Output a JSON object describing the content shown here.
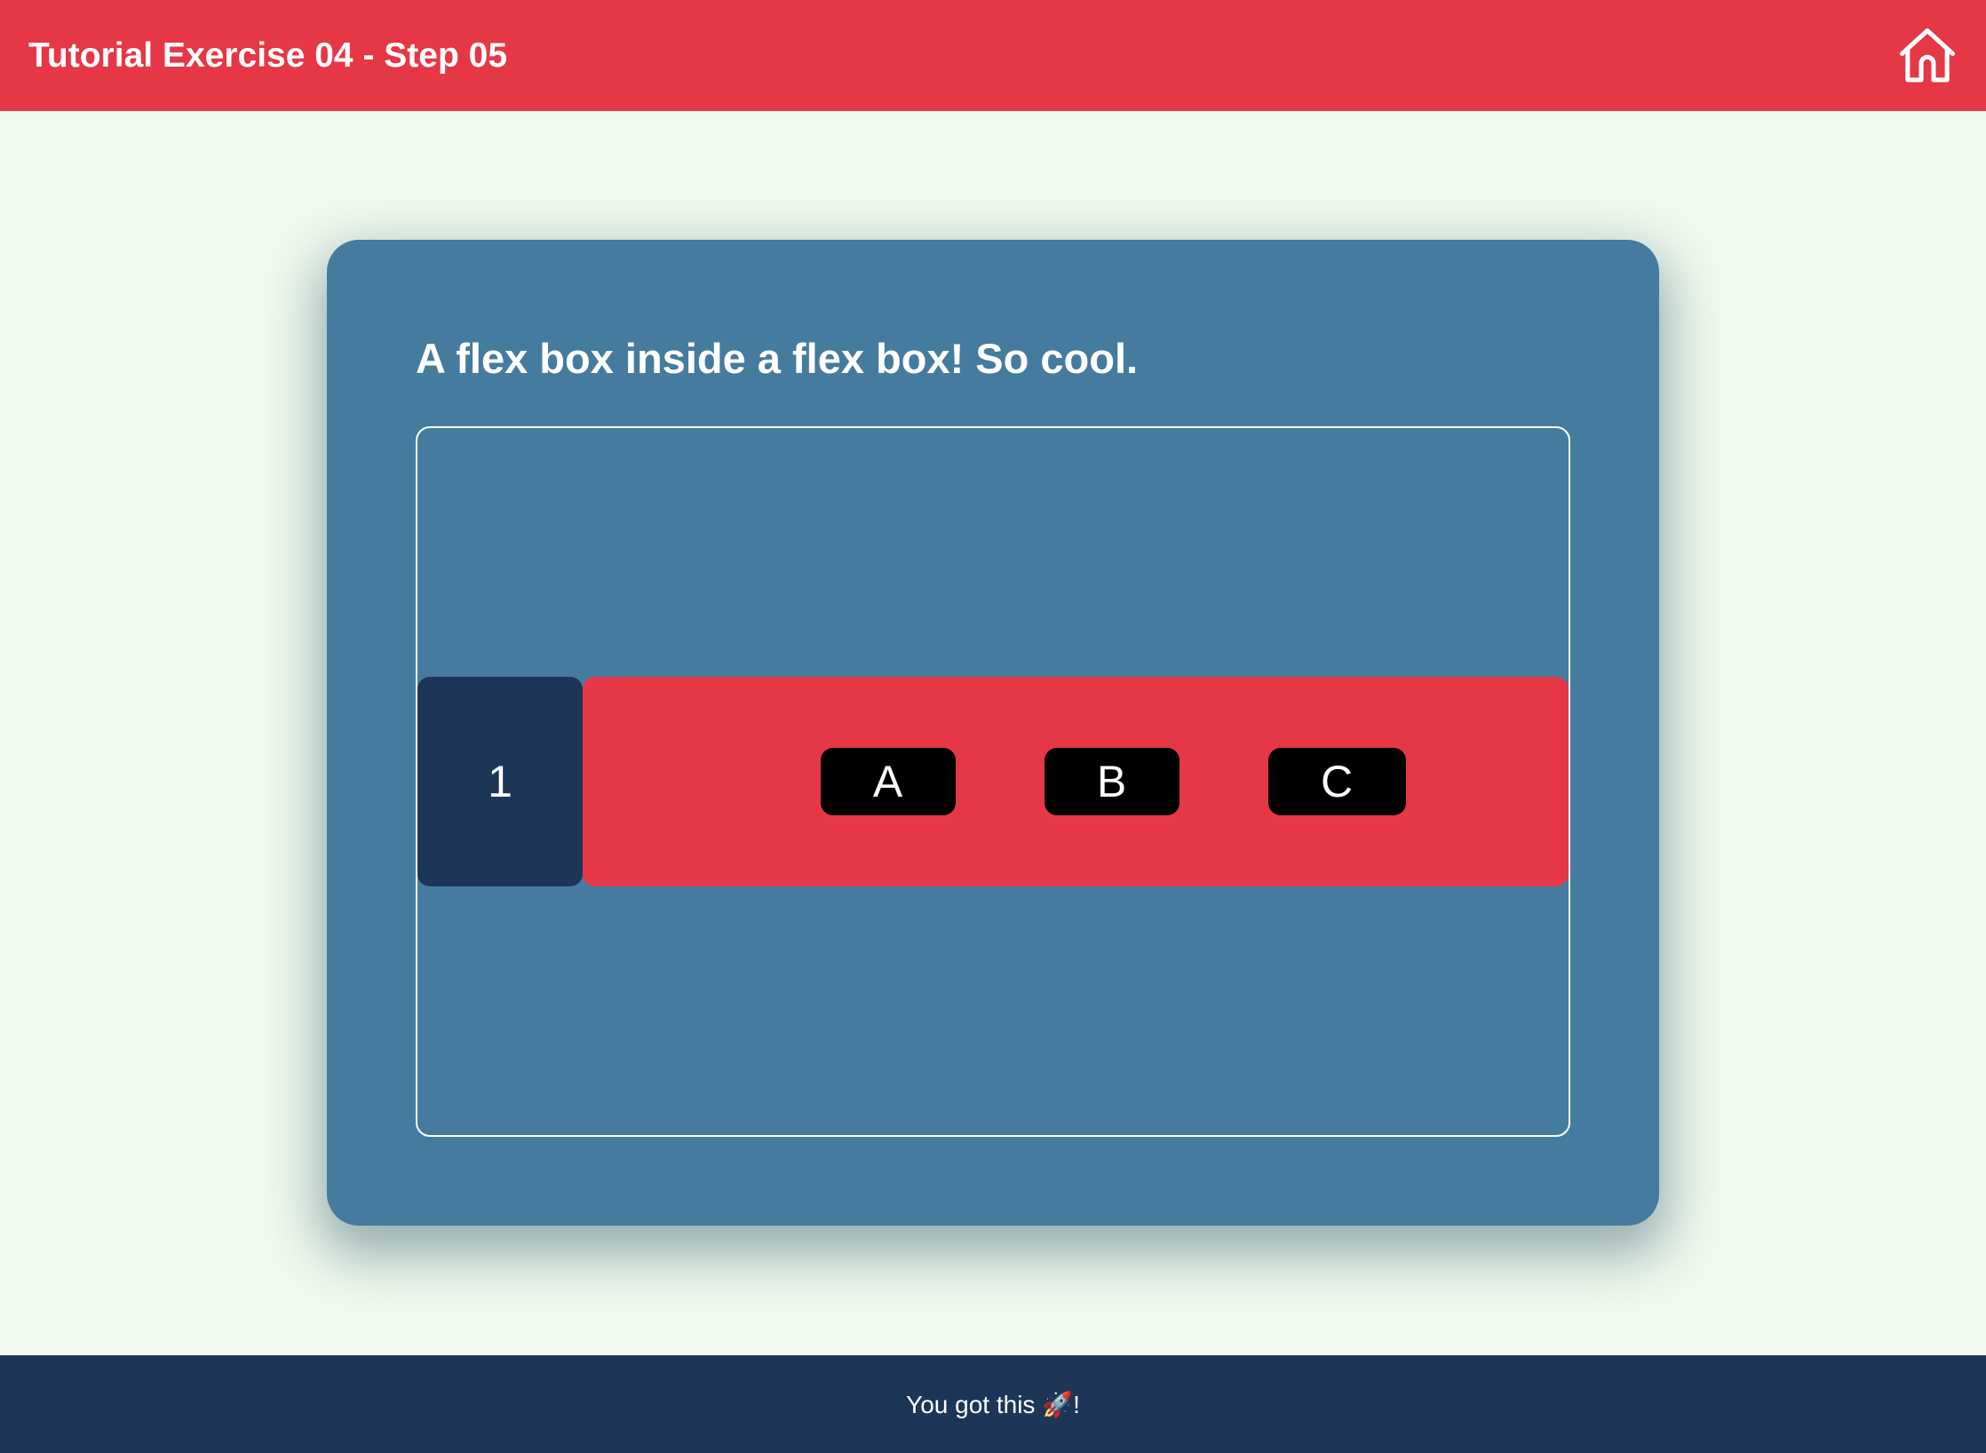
{
  "header": {
    "title": "Tutorial Exercise 04 - Step 05",
    "home_icon": "home-icon"
  },
  "card": {
    "heading": "A flex box inside a flex box! So cool."
  },
  "outer_flex": {
    "item_one": "1",
    "inner_items": [
      "A",
      "B",
      "C"
    ]
  },
  "footer": {
    "text": "You got this 🚀!"
  },
  "colors": {
    "header_bg": "#e63746",
    "page_bg": "#f0faee",
    "card_bg": "#457b9e",
    "item_one_bg": "#1d3557",
    "inner_flex_bg": "#e63746",
    "inner_item_bg": "#000000",
    "footer_bg": "#1d3557"
  }
}
